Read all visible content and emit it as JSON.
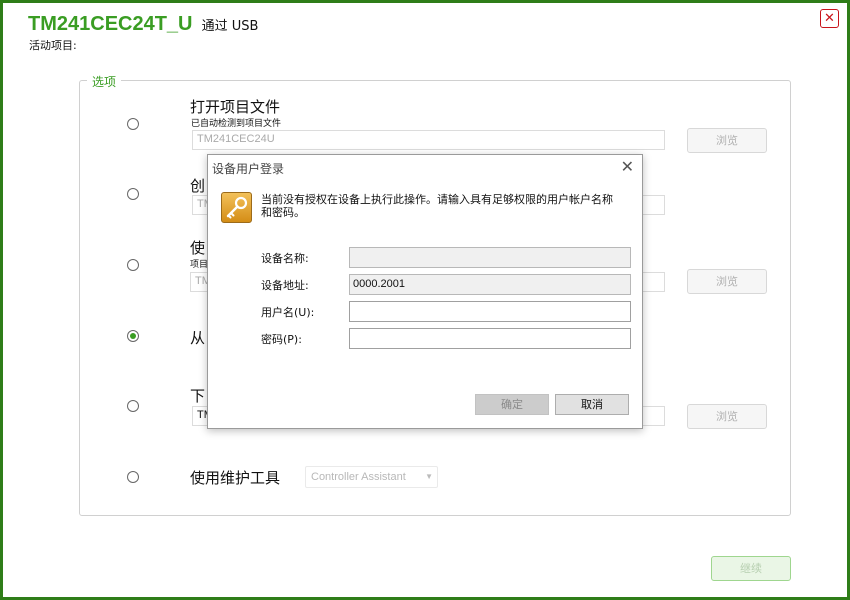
{
  "header": {
    "device": "TM241CEC24T_U",
    "via": "通过 USB",
    "active_project": "活动项目:",
    "close_symbol": "✕"
  },
  "options": {
    "legend": "选项",
    "items": [
      {
        "label": "打开项目文件",
        "hint": "已自动检测到项目文件",
        "field": "TM241CEC24U",
        "browse": "浏览",
        "selected": false
      },
      {
        "label": "创",
        "field": "TM",
        "selected": false
      },
      {
        "label": "使",
        "hint": "项目",
        "field": "TM",
        "browse": "浏览",
        "selected": false
      },
      {
        "label": "从",
        "selected": true
      },
      {
        "label": "下",
        "field": "TM",
        "browse": "浏览",
        "selected": false
      },
      {
        "label": "使用维护工具",
        "select_value": "Controller Assistant",
        "selected": false
      }
    ],
    "continue": "继续"
  },
  "dialog": {
    "title": "设备用户登录",
    "close_symbol": "✕",
    "message": "当前没有授权在设备上执行此操作。请输入具有足够权限的用户帐户名称和密码。",
    "fields": {
      "device_name_label": "设备名称:",
      "device_name_value": "",
      "device_address_label": "设备地址:",
      "device_address_value": "0000.2001",
      "username_label": "用户名(U):",
      "username_value": "",
      "password_label": "密码(P):",
      "password_value": ""
    },
    "ok": "确定",
    "cancel": "取消"
  },
  "colors": {
    "brand_green": "#3a9d23",
    "frame_green": "#2f7d18",
    "close_red": "#c8141b"
  },
  "icons": {
    "key": "key-icon",
    "close": "close-icon",
    "dropdown": "chevron-down-icon"
  }
}
